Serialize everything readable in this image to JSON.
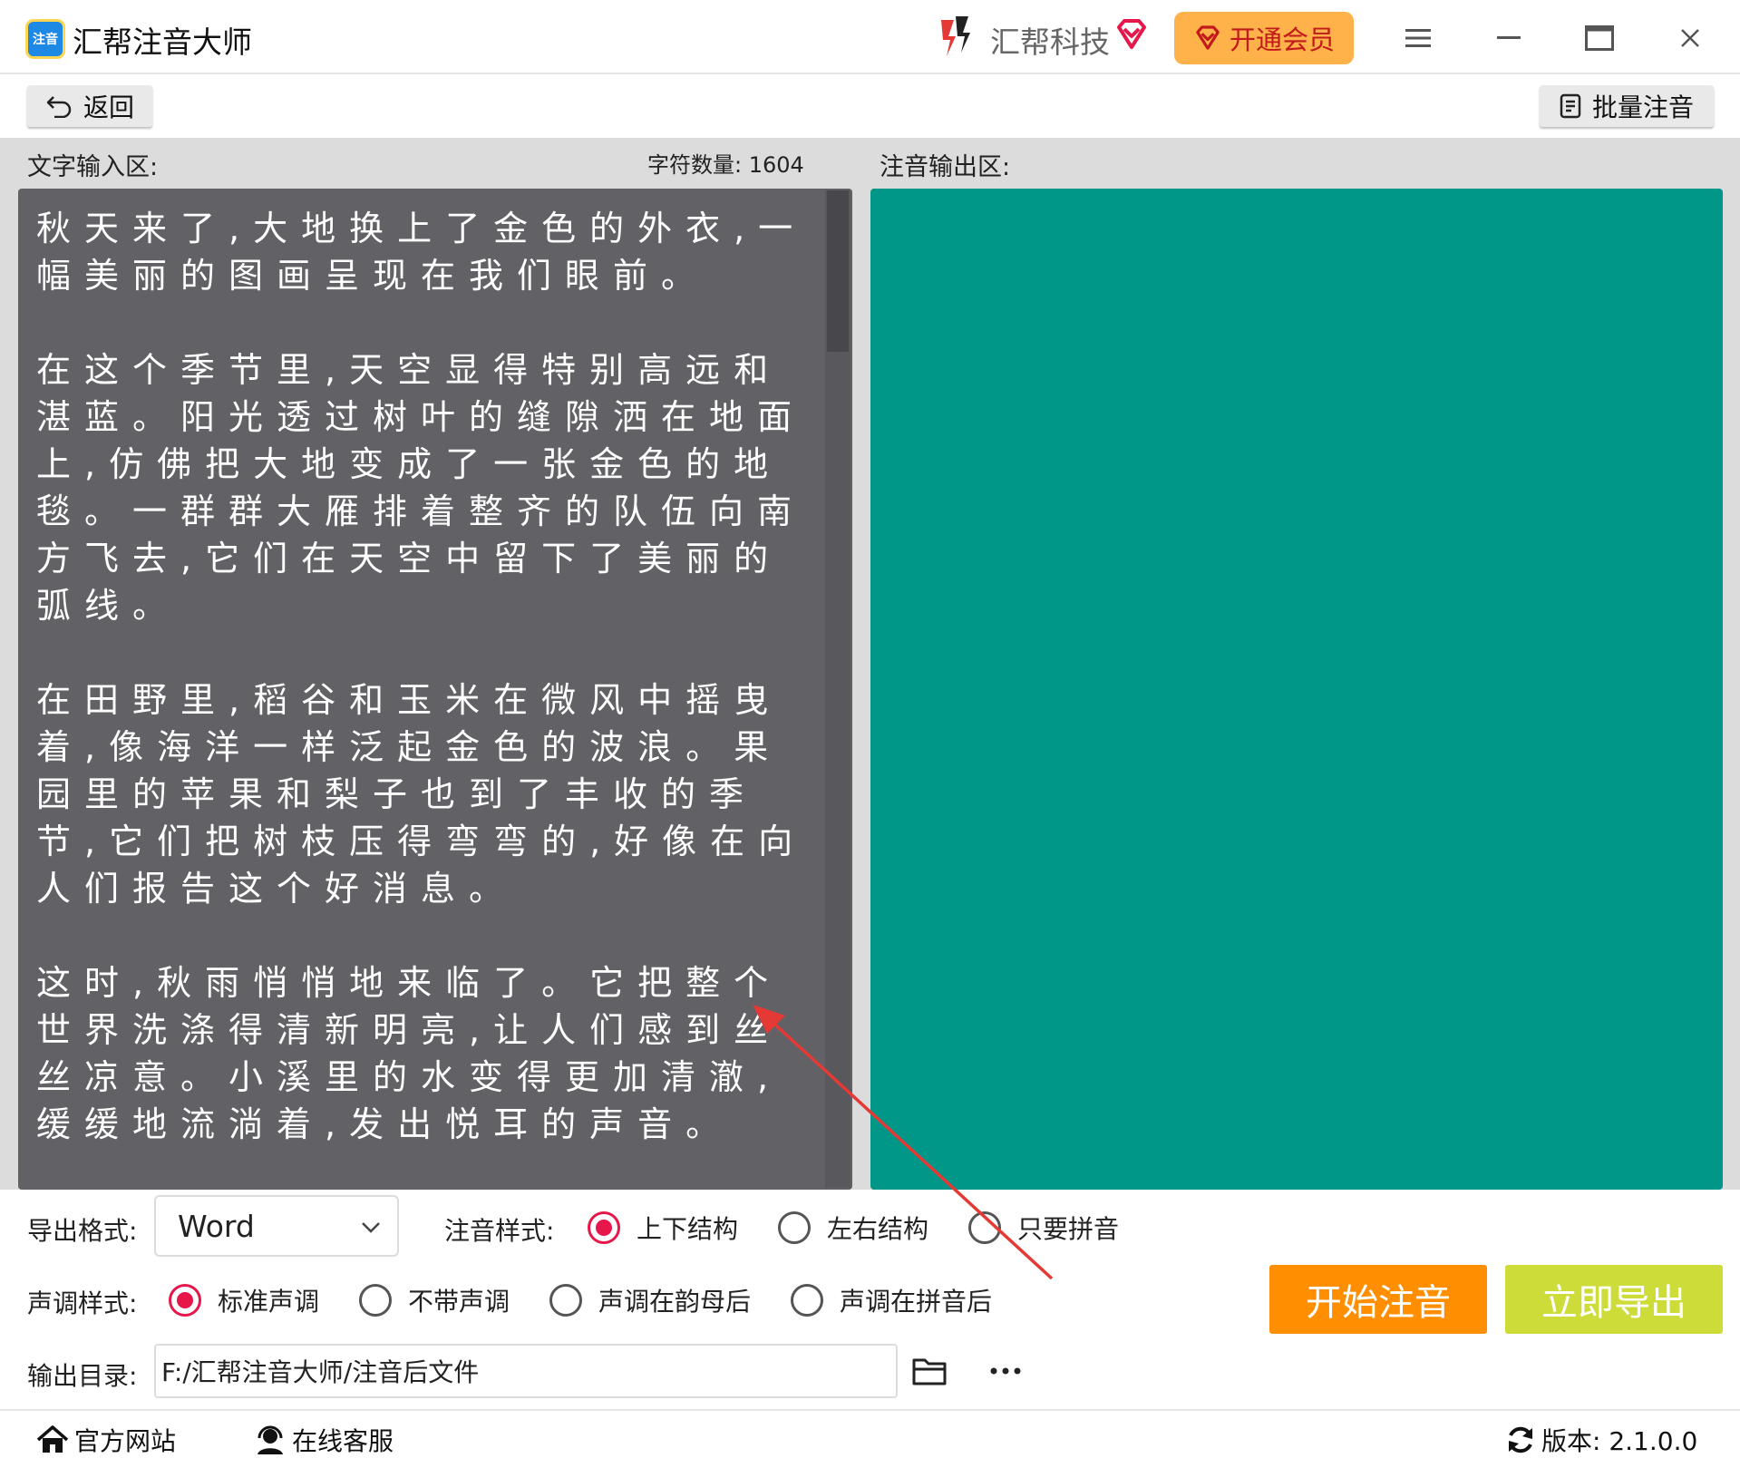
{
  "titlebar": {
    "app_title": "汇帮注音大师",
    "app_logo_text": "注音",
    "brand_name": "汇帮科技",
    "vip_label": "开通会员"
  },
  "toolbar": {
    "back_label": "返回",
    "batch_label": "批量注音"
  },
  "input": {
    "label": "文字输入区:",
    "char_count_label": "字符数量: 1604",
    "text": "秋天来了,大地换上了金色的外衣,一幅美丽的图画呈现在我们眼前。\n\n在这个季节里,天空显得特别高远和湛蓝。阳光透过树叶的缝隙洒在地面上,仿佛把大地变成了一张金色的地毯。一群群大雁排着整齐的队伍向南方飞去,它们在天空中留下了美丽的弧线。\n\n在田野里,稻谷和玉米在微风中摇曳着,像海洋一样泛起金色的波浪。果园里的苹果和梨子也到了丰收的季节,它们把树枝压得弯弯的,好像在向人们报告这个好消息。\n\n这时,秋雨悄悄地来临了。它把整个世界洗涤得清新明亮,让人们感到丝丝凉意。小溪里的水变得更加清澈,缓缓地流淌着,发出悦耳的声音。"
  },
  "output": {
    "label": "注音输出区:"
  },
  "settings": {
    "format_label": "导出格式:",
    "format_value": "Word",
    "annotation_style_label": "注音样式:",
    "annotation_styles": [
      {
        "label": "上下结构",
        "checked": true
      },
      {
        "label": "左右结构",
        "checked": false
      },
      {
        "label": "只要拼音",
        "checked": false
      }
    ],
    "tone_style_label": "声调样式:",
    "tone_styles": [
      {
        "label": "标准声调",
        "checked": true
      },
      {
        "label": "不带声调",
        "checked": false
      },
      {
        "label": "声调在韵母后",
        "checked": false
      },
      {
        "label": "声调在拼音后",
        "checked": false
      }
    ],
    "output_dir_label": "输出目录:",
    "output_dir_value": "F:/汇帮注音大师/注音后文件",
    "start_label": "开始注音",
    "export_label": "立即导出"
  },
  "statusbar": {
    "website_label": "官方网站",
    "service_label": "在线客服",
    "version_label": "版本: 2.1.0.0"
  },
  "colors": {
    "input_bg": "#616166",
    "output_bg": "#009688",
    "start_button": "#ff8f00",
    "export_button": "#cddc39",
    "radio_accent": "#e6174b",
    "vip_button": "#ffb24a"
  }
}
